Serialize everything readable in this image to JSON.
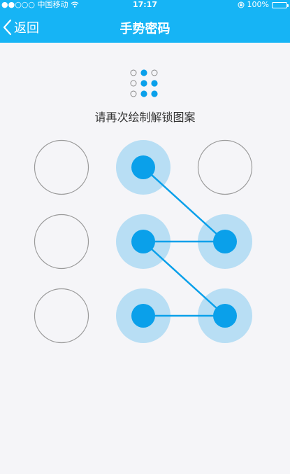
{
  "status_bar": {
    "carrier": "●●○○○ 中国移动",
    "time": "17:17",
    "battery_text": "100%"
  },
  "nav": {
    "back_label": "返回",
    "title": "手势密码"
  },
  "prompt_text": "请再次绘制解锁图案",
  "pattern": {
    "accent_color": "#0aa0ea",
    "halo_color": "#b8def4",
    "empty_ring_color": "#9a9a9a",
    "nodes": [
      {
        "id": 1,
        "selected": false
      },
      {
        "id": 2,
        "selected": true
      },
      {
        "id": 3,
        "selected": false
      },
      {
        "id": 4,
        "selected": false
      },
      {
        "id": 5,
        "selected": true
      },
      {
        "id": 6,
        "selected": true
      },
      {
        "id": 7,
        "selected": false
      },
      {
        "id": 8,
        "selected": true
      },
      {
        "id": 9,
        "selected": true
      }
    ],
    "sequence": [
      2,
      6,
      5,
      9,
      8
    ]
  }
}
